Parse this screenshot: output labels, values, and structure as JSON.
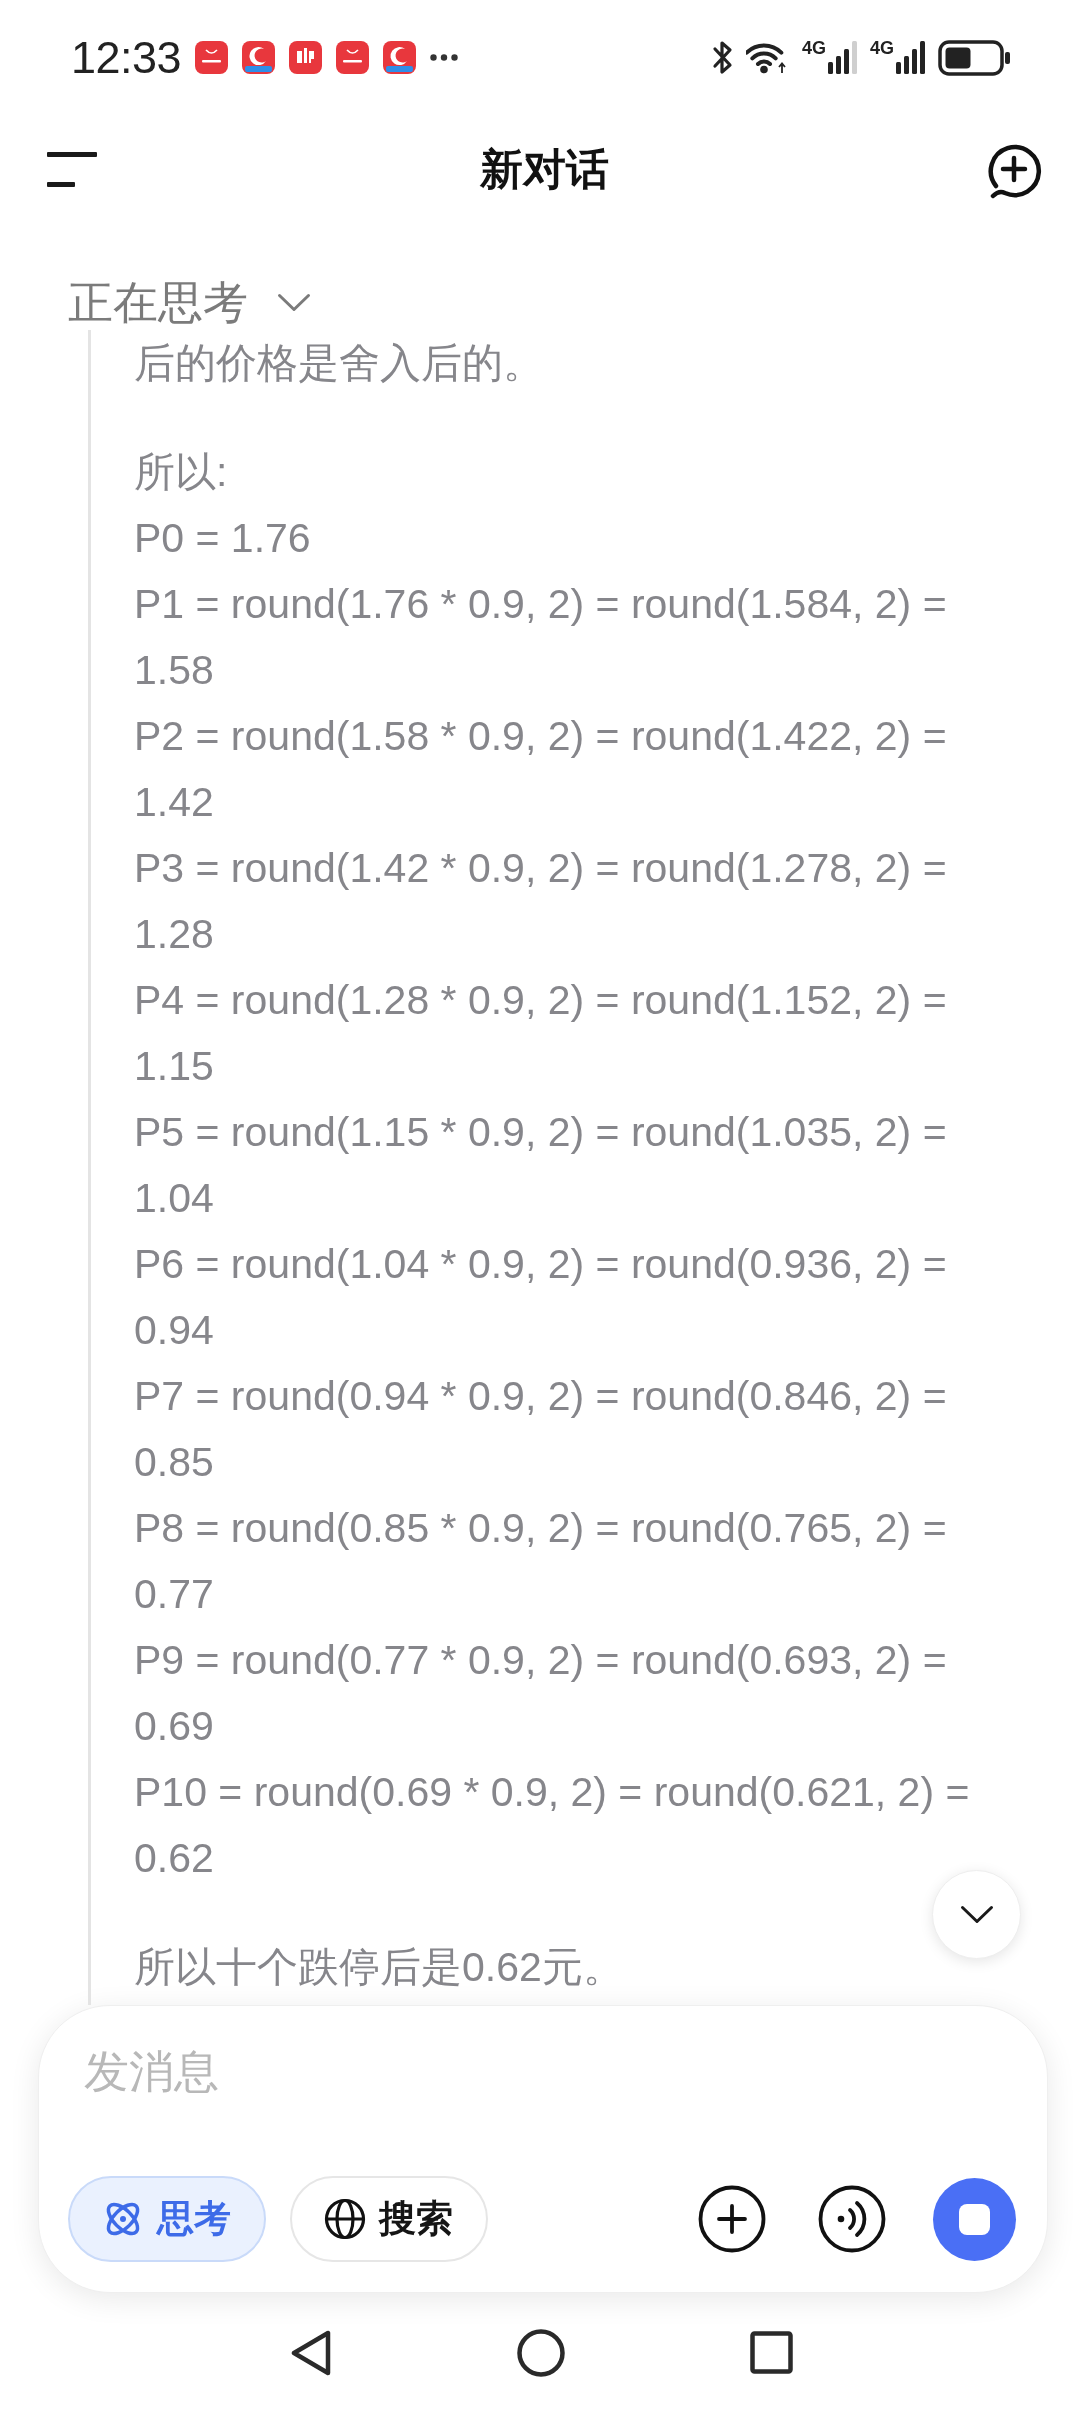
{
  "status_bar": {
    "time": "12:33",
    "signals": [
      {
        "label": "4G"
      },
      {
        "label": "4G"
      }
    ]
  },
  "header": {
    "title": "新对话"
  },
  "thinking": {
    "label": "正在思考",
    "expanded": true,
    "paragraphs": [
      {
        "lines": [
          "后的价格是舍入后的。"
        ]
      },
      {
        "lines": [
          "所以:",
          "P0 = 1.76",
          "P1 = round(1.76 * 0.9, 2) = round(1.584, 2) = 1.58",
          "P2 = round(1.58 * 0.9, 2) = round(1.422, 2) = 1.42",
          "P3 = round(1.42 * 0.9, 2) = round(1.278, 2) = 1.28",
          "P4 = round(1.28 * 0.9, 2) = round(1.152, 2) = 1.15",
          "P5 = round(1.15 * 0.9, 2) = round(1.035, 2) = 1.04",
          "P6 = round(1.04 * 0.9, 2) = round(0.936, 2) = 0.94",
          "P7 = round(0.94 * 0.9, 2) = round(0.846, 2) = 0.85",
          "P8 = round(0.85 * 0.9, 2) = round(0.765, 2) = 0.77",
          "P9 = round(0.77 * 0.9, 2) = round(0.693, 2) = 0.69",
          "P10 = round(0.69 * 0.9, 2) = round(0.621, 2) = 0.62"
        ]
      },
      {
        "lines": [
          "所以十个跌停后是0.62元。"
        ]
      }
    ]
  },
  "composer": {
    "placeholder": "发消息",
    "tools": [
      {
        "kind": "think",
        "label": "思考",
        "selected": true
      },
      {
        "kind": "search",
        "label": "搜索",
        "selected": false
      }
    ]
  }
}
